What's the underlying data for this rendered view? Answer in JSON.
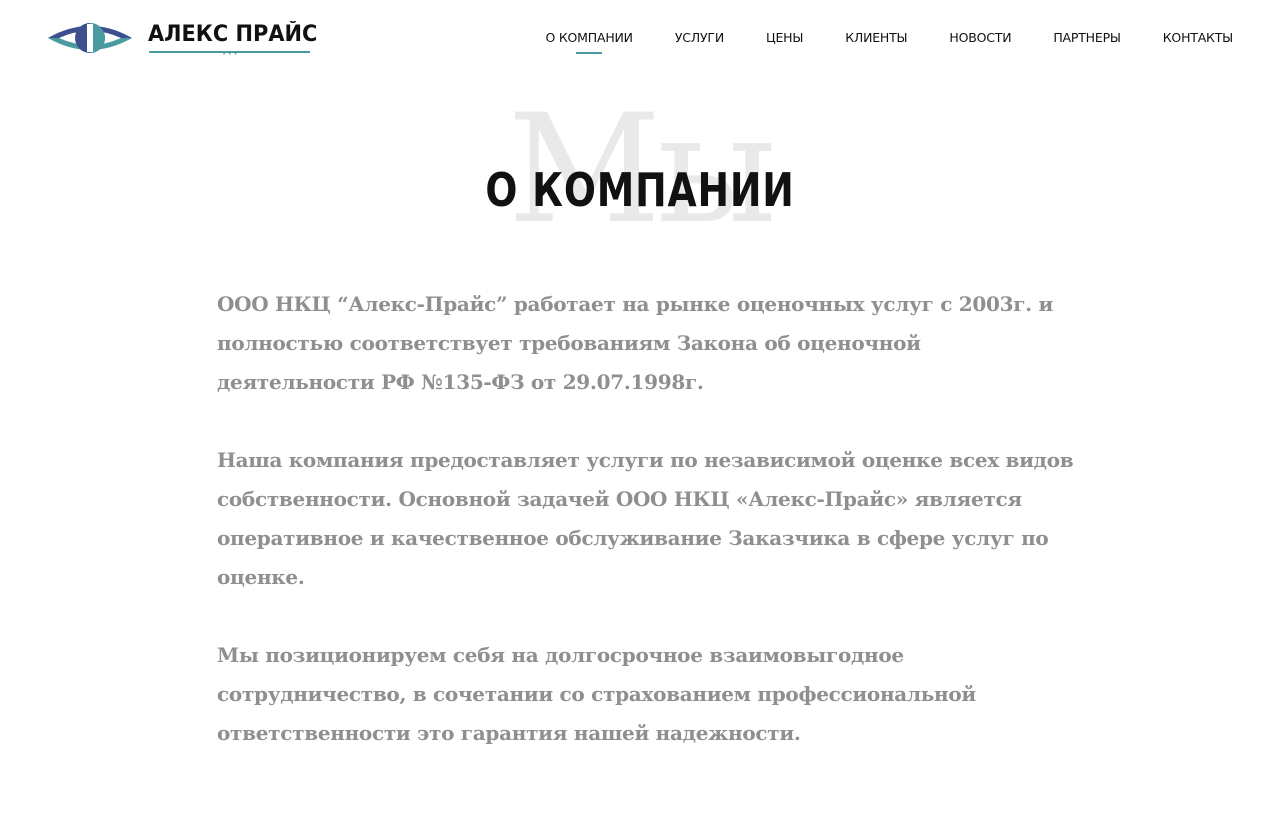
{
  "logo": {
    "text": "АЛЕКС ПРАЙС",
    "dots": "• • •",
    "colors": {
      "dark": "#3d4f8f",
      "accent": "#4a9ba0"
    }
  },
  "nav": {
    "items": [
      {
        "label": "О КОМПАНИИ",
        "active": true
      },
      {
        "label": "УСЛУГИ"
      },
      {
        "label": "ЦЕНЫ"
      },
      {
        "label": "КЛИЕНТЫ"
      },
      {
        "label": "НОВОСТИ"
      },
      {
        "label": "ПАРТНЕРЫ"
      },
      {
        "label": "КОНТАКТЫ"
      }
    ]
  },
  "section": {
    "background_word": "Мы",
    "title": "О КОМПАНИИ",
    "paragraphs": [
      "ООО НКЦ “Алекс-Прайс” работает на рынке оценочных услуг с 2003г. и полностью соответствует требованиям Закона об оценочной деятельности РФ №135-ФЗ от 29.07.1998г.",
      "Наша компания предоставляет услуги по независимой оценке всех видов собственности. Основной задачей ООО НКЦ «Алекс-Прайс» является оперативное и качественное обслуживание Заказчика в сфере услуг по оценке.",
      "Мы позиционируем себя на долгосрочное взаимовыгодное сотрудничество, в сочетании со страхованием профессиональной ответственности это гарантия нашей надежности."
    ]
  }
}
